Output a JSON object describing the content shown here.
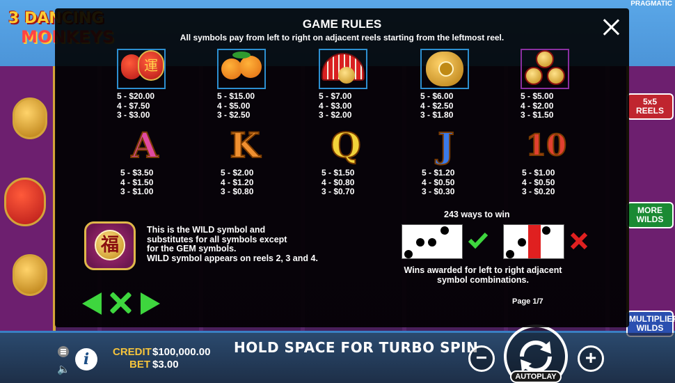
{
  "background": {
    "logo_line1": "3 DANCING",
    "logo_line2": "MONKEYS",
    "brand": "PRAGMATIC",
    "side_badges": {
      "reels": "5x5 REELS",
      "wilds": "MORE WILDS",
      "multiplier": "MULTIPLIER WILDS"
    }
  },
  "modal": {
    "title": "GAME RULES",
    "subtitle": "All symbols pay from left to right on adjacent reels starting from the leftmost reel.",
    "symbols_row1": [
      {
        "icon": "lantern",
        "pays": [
          "5 - $20.00",
          "4 - $7.50",
          "3 - $3.00"
        ]
      },
      {
        "icon": "oranges",
        "pays": [
          "5 - $15.00",
          "4 - $5.00",
          "3 - $2.50"
        ]
      },
      {
        "icon": "fan",
        "pays": [
          "5 - $7.00",
          "4 - $3.00",
          "3 - $2.00"
        ]
      },
      {
        "icon": "pouch",
        "pays": [
          "5 - $6.00",
          "4 - $2.50",
          "3 - $1.80"
        ]
      },
      {
        "icon": "coins",
        "pays": [
          "5 - $5.00",
          "4 - $2.00",
          "3 - $1.50"
        ]
      }
    ],
    "symbols_row2": [
      {
        "letter": "A",
        "pays": [
          "5 - $3.50",
          "4 - $1.50",
          "3 - $1.00"
        ]
      },
      {
        "letter": "K",
        "pays": [
          "5 - $2.00",
          "4 - $1.20",
          "3 - $0.80"
        ]
      },
      {
        "letter": "Q",
        "pays": [
          "5 - $1.50",
          "4 - $0.80",
          "3 - $0.70"
        ]
      },
      {
        "letter": "J",
        "pays": [
          "5 - $1.20",
          "4 - $0.50",
          "3 - $0.30"
        ]
      },
      {
        "letter": "10",
        "pays": [
          "5 - $1.00",
          "4 - $0.50",
          "3 - $0.20"
        ]
      }
    ],
    "wild_text": [
      "This is the WILD symbol and",
      "substitutes for all symbols except",
      "for the GEM symbols.",
      "WILD symbol appears on reels 2, 3 and 4."
    ],
    "wild_glyph": "福",
    "ways_title": "243 ways to win",
    "ways_note": [
      "Wins awarded for left to right adjacent",
      "symbol combinations."
    ],
    "page": "Page 1/7"
  },
  "bottom_bar": {
    "credit_label": "CREDIT",
    "credit_value": "$100,000.00",
    "bet_label": "BET",
    "bet_value": "$3.00",
    "turbo_message": "HOLD SPACE FOR TURBO SPIN",
    "autoplay": "AUTOPLAY",
    "info": "i",
    "minus": "−",
    "plus": "+"
  },
  "colors": {
    "accent_green": "#3ed63e",
    "gold": "#f4c33c",
    "error_red": "#e02020"
  }
}
